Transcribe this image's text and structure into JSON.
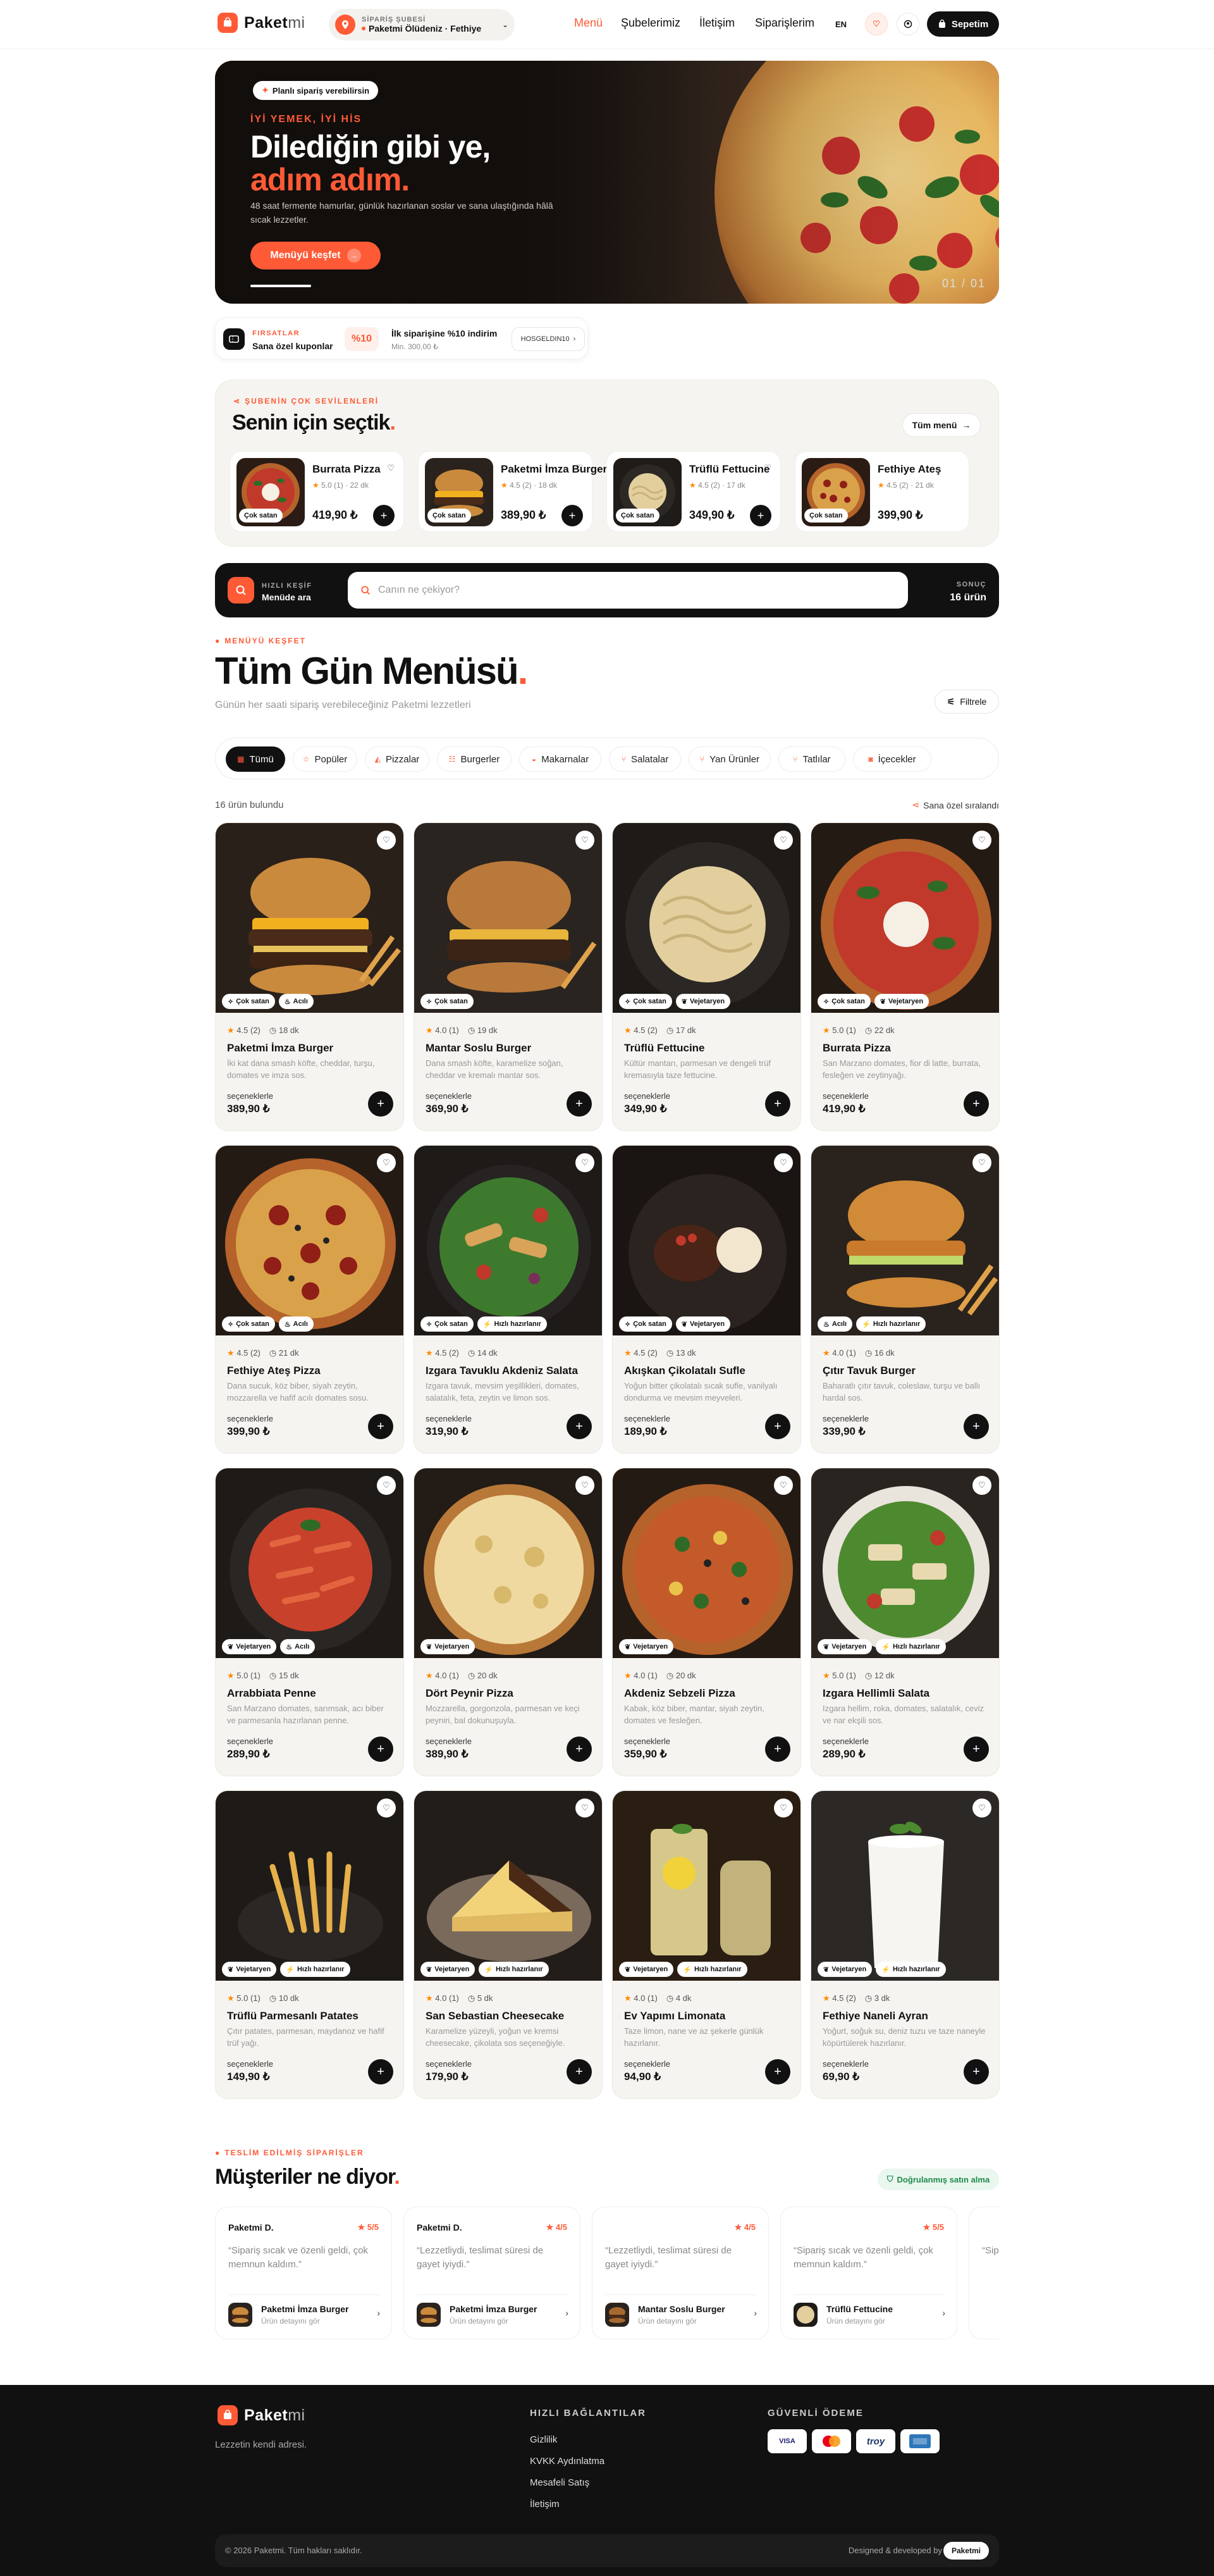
{
  "header": {
    "brand_a": "Paket",
    "brand_b": "mi",
    "branch_label": "SİPARİŞ ŞUBESİ",
    "branch_value": "Paketmi Ölüdeniz · Fethiye",
    "nav": [
      "Menü",
      "Şubelerimiz",
      "İletişim",
      "Siparişlerim"
    ],
    "lang": "EN",
    "cart": "Sepetim"
  },
  "hero": {
    "badge": "Planlı sipariş verebilirsin",
    "kicker": "İYİ YEMEK, İYİ HİS",
    "title_a": "Dilediğin gibi ye,",
    "title_b": "adım adım.",
    "desc": "48 saat fermente hamurlar, günlük hazırlanan soslar ve sana ulaştığında hâlâ sıcak lezzetler.",
    "cta": "Menüyü keşfet",
    "counter": "01 / 01"
  },
  "promo": {
    "kicker": "FIRSATLAR",
    "title": "Sana özel kuponlar",
    "pct": "%10",
    "offer_title": "İlk siparişine %10 indirim",
    "offer_sub": "Min. 300,00 ₺",
    "code": "HOSGELDIN10"
  },
  "chosen": {
    "kicker": "ŞUBENİN ÇOK SEVİLENLERİ",
    "title": "Senin için seçtik",
    "all_menu": "Tüm menü",
    "items": [
      {
        "name": "Burrata Pizza",
        "rating": "5.0",
        "reviews": "(1)",
        "time": "22 dk",
        "price": "419,90 ₺",
        "badge": "Çok satan"
      },
      {
        "name": "Paketmi İmza Burger",
        "rating": "4.5",
        "reviews": "(2)",
        "time": "18 dk",
        "price": "389,90 ₺",
        "badge": "Çok satan"
      },
      {
        "name": "Trüflü Fettucine",
        "rating": "4.5",
        "reviews": "(2)",
        "time": "17 dk",
        "price": "349,90 ₺",
        "badge": "Çok satan"
      },
      {
        "name": "Fethiye Ateş",
        "rating": "4.5",
        "reviews": "(2)",
        "time": "21 dk",
        "price": "399,90 ₺",
        "badge": "Çok satan"
      }
    ]
  },
  "search": {
    "kicker": "HIZLI KEŞİF",
    "title": "Menüde ara",
    "placeholder": "Canın ne çekiyor?",
    "result_label": "SONUÇ",
    "result_value": "16 ürün"
  },
  "menu": {
    "kicker": "MENÜYÜ KEŞFET",
    "title": "Tüm Gün Menüsü",
    "subtitle": "Günün her saati sipariş verebileceğiniz Paketmi lezzetleri",
    "filter": "Filtrele",
    "categories": [
      "Tümü",
      "Popüler",
      "Pizzalar",
      "Burgerler",
      "Makarnalar",
      "Salatalar",
      "Yan Ürünler",
      "Tatlılar",
      "İçecekler"
    ],
    "count": "16 ürün bulundu",
    "sort": "Sana özel sıralandı",
    "price_label": "seçeneklerle"
  },
  "products": [
    {
      "name": "Paketmi İmza Burger",
      "rating": "4.5",
      "reviews": "(2)",
      "time": "18 dk",
      "desc": "İki kat dana smash köfte, cheddar, turşu, domates ve imza sos.",
      "price": "389,90 ₺",
      "tags": [
        "Çok satan",
        "Acılı"
      ]
    },
    {
      "name": "Mantar Soslu Burger",
      "rating": "4.0",
      "reviews": "(1)",
      "time": "19 dk",
      "desc": "Dana smash köfte, karamelize soğan, cheddar ve kremalı mantar sos.",
      "price": "369,90 ₺",
      "tags": [
        "Çok satan"
      ]
    },
    {
      "name": "Trüflü Fettucine",
      "rating": "4.5",
      "reviews": "(2)",
      "time": "17 dk",
      "desc": "Kültür mantarı, parmesan ve dengeli trüf kremasıyla taze fettucine.",
      "price": "349,90 ₺",
      "tags": [
        "Çok satan",
        "Vejetaryen"
      ]
    },
    {
      "name": "Burrata Pizza",
      "rating": "5.0",
      "reviews": "(1)",
      "time": "22 dk",
      "desc": "San Marzano domates, fior di latte, burrata, fesleğen ve zeytinyağı.",
      "price": "419,90 ₺",
      "tags": [
        "Çok satan",
        "Vejetaryen"
      ]
    },
    {
      "name": "Fethiye Ateş Pizza",
      "rating": "4.5",
      "reviews": "(2)",
      "time": "21 dk",
      "desc": "Dana sucuk, köz biber, siyah zeytin, mozzarella ve hafif acılı domates sosu.",
      "price": "399,90 ₺",
      "tags": [
        "Çok satan",
        "Acılı"
      ]
    },
    {
      "name": "Izgara Tavuklu Akdeniz Salata",
      "rating": "4.5",
      "reviews": "(2)",
      "time": "14 dk",
      "desc": "Izgara tavuk, mevsim yeşillikleri, domates, salatalık, feta, zeytin ve limon sos.",
      "price": "319,90 ₺",
      "tags": [
        "Çok satan",
        "Hızlı hazırlanır"
      ]
    },
    {
      "name": "Akışkan Çikolatalı Sufle",
      "rating": "4.5",
      "reviews": "(2)",
      "time": "13 dk",
      "desc": "Yoğun bitter çikolatalı sıcak sufle, vanilyalı dondurma ve mevsim meyveleri.",
      "price": "189,90 ₺",
      "tags": [
        "Çok satan",
        "Vejetaryen"
      ]
    },
    {
      "name": "Çıtır Tavuk Burger",
      "rating": "4.0",
      "reviews": "(1)",
      "time": "16 dk",
      "desc": "Baharatlı çıtır tavuk, coleslaw, turşu ve ballı hardal sos.",
      "price": "339,90 ₺",
      "tags": [
        "Acılı",
        "Hızlı hazırlanır"
      ]
    },
    {
      "name": "Arrabbiata Penne",
      "rating": "5.0",
      "reviews": "(1)",
      "time": "15 dk",
      "desc": "San Marzano domates, sarımsak, acı biber ve parmesanla hazırlanan penne.",
      "price": "289,90 ₺",
      "tags": [
        "Vejetaryen",
        "Acılı"
      ]
    },
    {
      "name": "Dört Peynir Pizza",
      "rating": "4.0",
      "reviews": "(1)",
      "time": "20 dk",
      "desc": "Mozzarella, gorgonzola, parmesan ve keçi peyniri, bal dokunuşuyla.",
      "price": "389,90 ₺",
      "tags": [
        "Vejetaryen"
      ]
    },
    {
      "name": "Akdeniz Sebzeli Pizza",
      "rating": "4.0",
      "reviews": "(1)",
      "time": "20 dk",
      "desc": "Kabak, köz biber, mantar, siyah zeytin, domates ve fesleğen.",
      "price": "359,90 ₺",
      "tags": [
        "Vejetaryen"
      ]
    },
    {
      "name": "Izgara Hellimli Salata",
      "rating": "5.0",
      "reviews": "(1)",
      "time": "12 dk",
      "desc": "Izgara hellim, roka, domates, salatalık, ceviz ve nar ekşili sos.",
      "price": "289,90 ₺",
      "tags": [
        "Vejetaryen",
        "Hızlı hazırlanır"
      ]
    },
    {
      "name": "Trüflü Parmesanlı Patates",
      "rating": "5.0",
      "reviews": "(1)",
      "time": "10 dk",
      "desc": "Çıtır patates, parmesan, maydanoz ve hafif trüf yağı.",
      "price": "149,90 ₺",
      "tags": [
        "Vejetaryen",
        "Hızlı hazırlanır"
      ]
    },
    {
      "name": "San Sebastian Cheesecake",
      "rating": "4.0",
      "reviews": "(1)",
      "time": "5 dk",
      "desc": "Karamelize yüzeyli, yoğun ve kremsi cheesecake, çikolata sos seçeneğiyle.",
      "price": "179,90 ₺",
      "tags": [
        "Vejetaryen",
        "Hızlı hazırlanır"
      ]
    },
    {
      "name": "Ev Yapımı Limonata",
      "rating": "4.0",
      "reviews": "(1)",
      "time": "4 dk",
      "desc": "Taze limon, nane ve az şekerle günlük hazırlanır.",
      "price": "94,90 ₺",
      "tags": [
        "Vejetaryen",
        "Hızlı hazırlanır"
      ]
    },
    {
      "name": "Fethiye Naneli Ayran",
      "rating": "4.5",
      "reviews": "(2)",
      "time": "3 dk",
      "desc": "Yoğurt, soğuk su, deniz tuzu ve taze naneyle köpürtülerek hazırlanır.",
      "price": "69,90 ₺",
      "tags": [
        "Vejetaryen",
        "Hızlı hazırlanır"
      ]
    }
  ],
  "reviews": {
    "kicker": "TESLİM EDİLMİŞ SİPARİŞLER",
    "title": "Müşteriler ne diyor",
    "verified": "Doğrulanmış satın alma",
    "product_sub": "Ürün detayını gör",
    "items": [
      {
        "who": "Paketmi D.",
        "score": "5/5",
        "quote": "“Sipariş sıcak ve özenli geldi, çok memnun kaldım.”",
        "product": "Paketmi İmza Burger"
      },
      {
        "who": "Paketmi D.",
        "score": "4/5",
        "quote": "“Lezzetliydi, teslimat süresi de gayet iyiydi.”",
        "product": "Paketmi İmza Burger"
      },
      {
        "who": "",
        "score": "4/5",
        "quote": "“Lezzetliydi, teslimat süresi de gayet iyiydi.”",
        "product": "Mantar Soslu Burger"
      },
      {
        "who": "",
        "score": "5/5",
        "quote": "“Sipariş sıcak ve özenli geldi, çok memnun kaldım.”",
        "product": "Trüflü Fettucine"
      }
    ]
  },
  "footer": {
    "tagline": "Lezzetin kendi adresi.",
    "links_head": "HIZLI BAĞLANTILAR",
    "links": [
      "Gizlilik",
      "KVKK Aydınlatma",
      "Mesafeli Satış",
      "İletişim"
    ],
    "pay_head": "GÜVENLİ ÖDEME",
    "payments": [
      "VISA",
      "troy"
    ],
    "copyright": "© 2026 Paketmi. Tüm hakları saklıdır.",
    "designed": "Designed & developed by",
    "designed_brand": "Paketmi"
  },
  "colors": {
    "accent": "#ff5a36",
    "dark": "#111111",
    "card": "#f6f4f0"
  }
}
